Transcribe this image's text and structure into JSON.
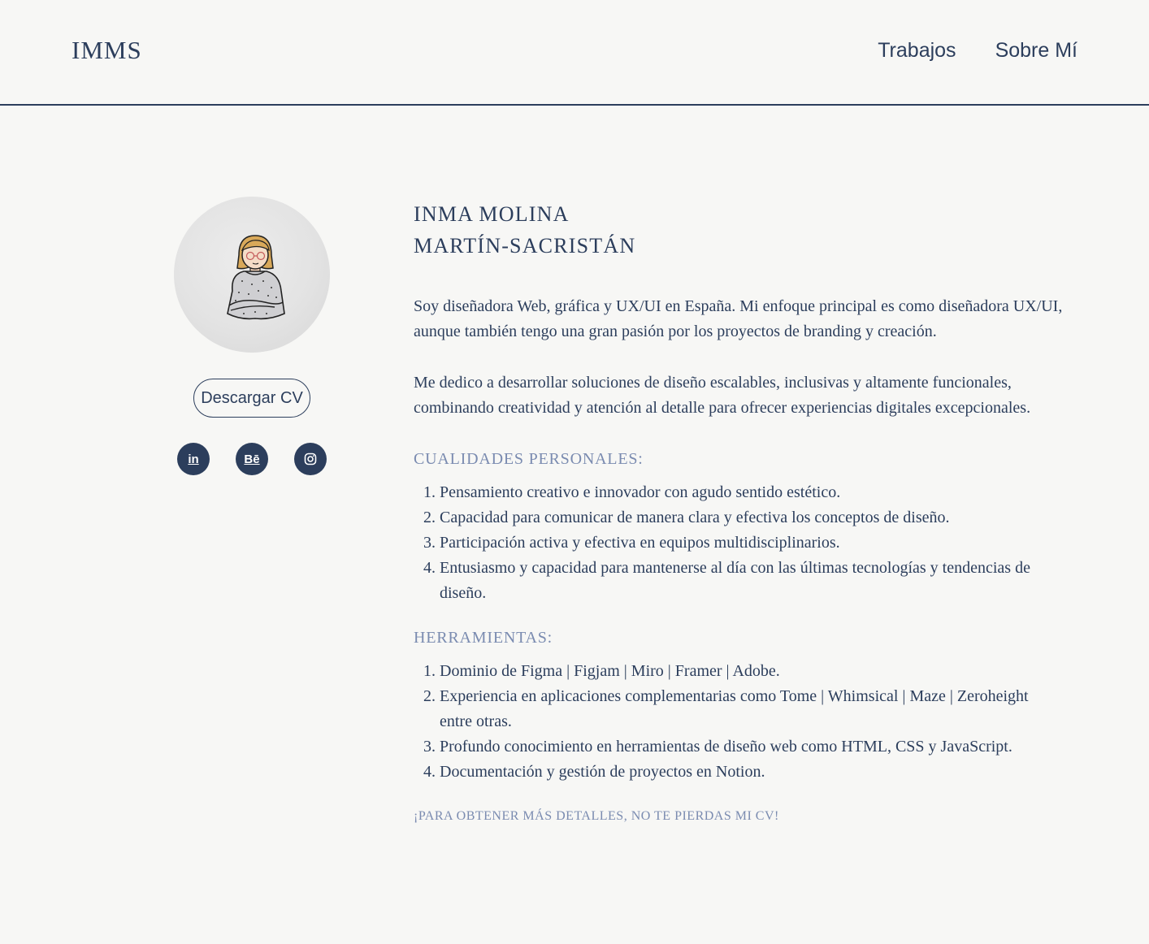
{
  "header": {
    "logo": "IMMS",
    "nav": [
      {
        "label": "Trabajos"
      },
      {
        "label": "Sobre Mí"
      }
    ]
  },
  "profile": {
    "cv_button": "Descargar CV",
    "socials": [
      {
        "label": "in",
        "icon": "linkedin-icon"
      },
      {
        "label": "Bē",
        "icon": "behance-icon"
      },
      {
        "label": "instagram",
        "icon": "instagram-icon"
      }
    ]
  },
  "about": {
    "name_line1": "INMA MOLINA",
    "name_line2": "MARTÍN-SACRISTÁN",
    "paragraph1": "Soy diseñadora Web, gráfica y UX/UI en España. Mi enfoque principal es como diseñadora UX/UI, aunque también tengo una gran pasión por los proyectos de branding y creación.",
    "paragraph2": "Me dedico a desarrollar soluciones de diseño escalables, inclusivas y altamente funcionales, combinando creatividad y atención al detalle para ofrecer experiencias digitales excepcionales.",
    "qualities_title": "CUALIDADES PERSONALES:",
    "qualities": [
      "Pensamiento creativo e innovador con agudo sentido estético.",
      "Capacidad para comunicar de manera clara y efectiva los conceptos de diseño.",
      "Participación activa y efectiva en equipos multidisciplinarios.",
      "Entusiasmo y capacidad para mantenerse al día con las últimas tecnologías y tendencias de diseño."
    ],
    "tools_title": "HERRAMIENTAS:",
    "tools": [
      "Dominio de Figma | Figjam | Miro | Framer | Adobe.",
      "Experiencia en aplicaciones complementarias como Tome | Whimsical | Maze | Zeroheight entre otras.",
      "Profundo conocimiento en herramientas de diseño web como HTML, CSS y JavaScript.",
      "Documentación y gestión de proyectos en Notion."
    ],
    "cta": "¡PARA OBTENER MÁS DETALLES, NO TE PIERDAS MI CV!"
  },
  "colors": {
    "primary": "#2c3e5c",
    "accent": "#7a8bb0",
    "background": "#f7f7f5"
  }
}
